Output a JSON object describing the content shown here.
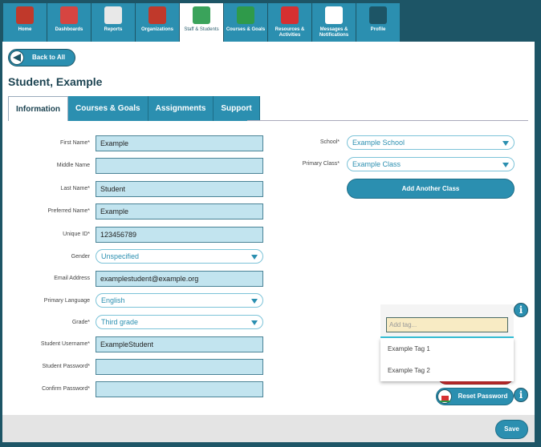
{
  "nav": {
    "items": [
      {
        "label": "Home",
        "icon": "house-icon",
        "color": "#c0392b",
        "active": false
      },
      {
        "label": "Dashboards",
        "icon": "gauge-icon",
        "color": "#d64541",
        "active": false
      },
      {
        "label": "Reports",
        "icon": "report-icon",
        "color": "#e8e8e8",
        "active": false
      },
      {
        "label": "Organizations",
        "icon": "school-building-icon",
        "color": "#c0392b",
        "active": false
      },
      {
        "label": "Staff & Students",
        "icon": "people-icon",
        "color": "#3aa35b",
        "active": true
      },
      {
        "label": "Courses & Goals",
        "icon": "chalkboard-icon",
        "color": "#2f9a4a",
        "active": false
      },
      {
        "label": "Resources & Activities",
        "icon": "puzzle-icon",
        "color": "#d63031",
        "active": false
      },
      {
        "label": "Messages & Notifications",
        "icon": "envelope-icon",
        "color": "#ffffff",
        "active": false
      },
      {
        "label": "Profile",
        "icon": "profile-icon",
        "color": "#1d5566",
        "active": false
      }
    ]
  },
  "back_label": "Back to All",
  "page_title": "Student, Example",
  "tabs": [
    {
      "label": "Information",
      "active": true
    },
    {
      "label": "Courses & Goals"
    },
    {
      "label": "Assignments"
    },
    {
      "label": "Support"
    }
  ],
  "form": {
    "fields": [
      {
        "label": "First Name*",
        "value": "Example",
        "type": "text"
      },
      {
        "label": "Middle Name",
        "value": "",
        "type": "text"
      },
      {
        "label": "Last Name*",
        "value": "Student",
        "type": "text"
      },
      {
        "label": "Preferred Name*",
        "value": "Example",
        "type": "text"
      },
      {
        "label": "Unique ID*",
        "value": "123456789",
        "type": "text"
      },
      {
        "label": "Gender",
        "value": "Unspecified",
        "type": "select"
      },
      {
        "label": "Email Address",
        "value": "examplestudent@example.org",
        "type": "text"
      },
      {
        "label": "Primary Language",
        "value": "English",
        "type": "select"
      },
      {
        "label": "Grade*",
        "value": "Third grade",
        "type": "select"
      },
      {
        "label": "Student Username*",
        "value": "ExampleStudent",
        "type": "text"
      },
      {
        "label": "Student Password*",
        "value": "",
        "type": "password"
      },
      {
        "label": "Confirm Password*",
        "value": "",
        "type": "password"
      }
    ]
  },
  "school": {
    "label": "School*",
    "value": "Example School"
  },
  "primary_class": {
    "label": "Primary Class*",
    "value": "Example Class"
  },
  "add_class_label": "Add Another Class",
  "tags": {
    "placeholder": "Add tag...",
    "options": [
      "Example Tag 1",
      "Example Tag 2"
    ]
  },
  "reset_password_label": "Reset Password",
  "save_label": "Save",
  "colors": {
    "frame": "#1d5566",
    "accent": "#2b8fb0",
    "input_bg": "#c2e4ef"
  }
}
